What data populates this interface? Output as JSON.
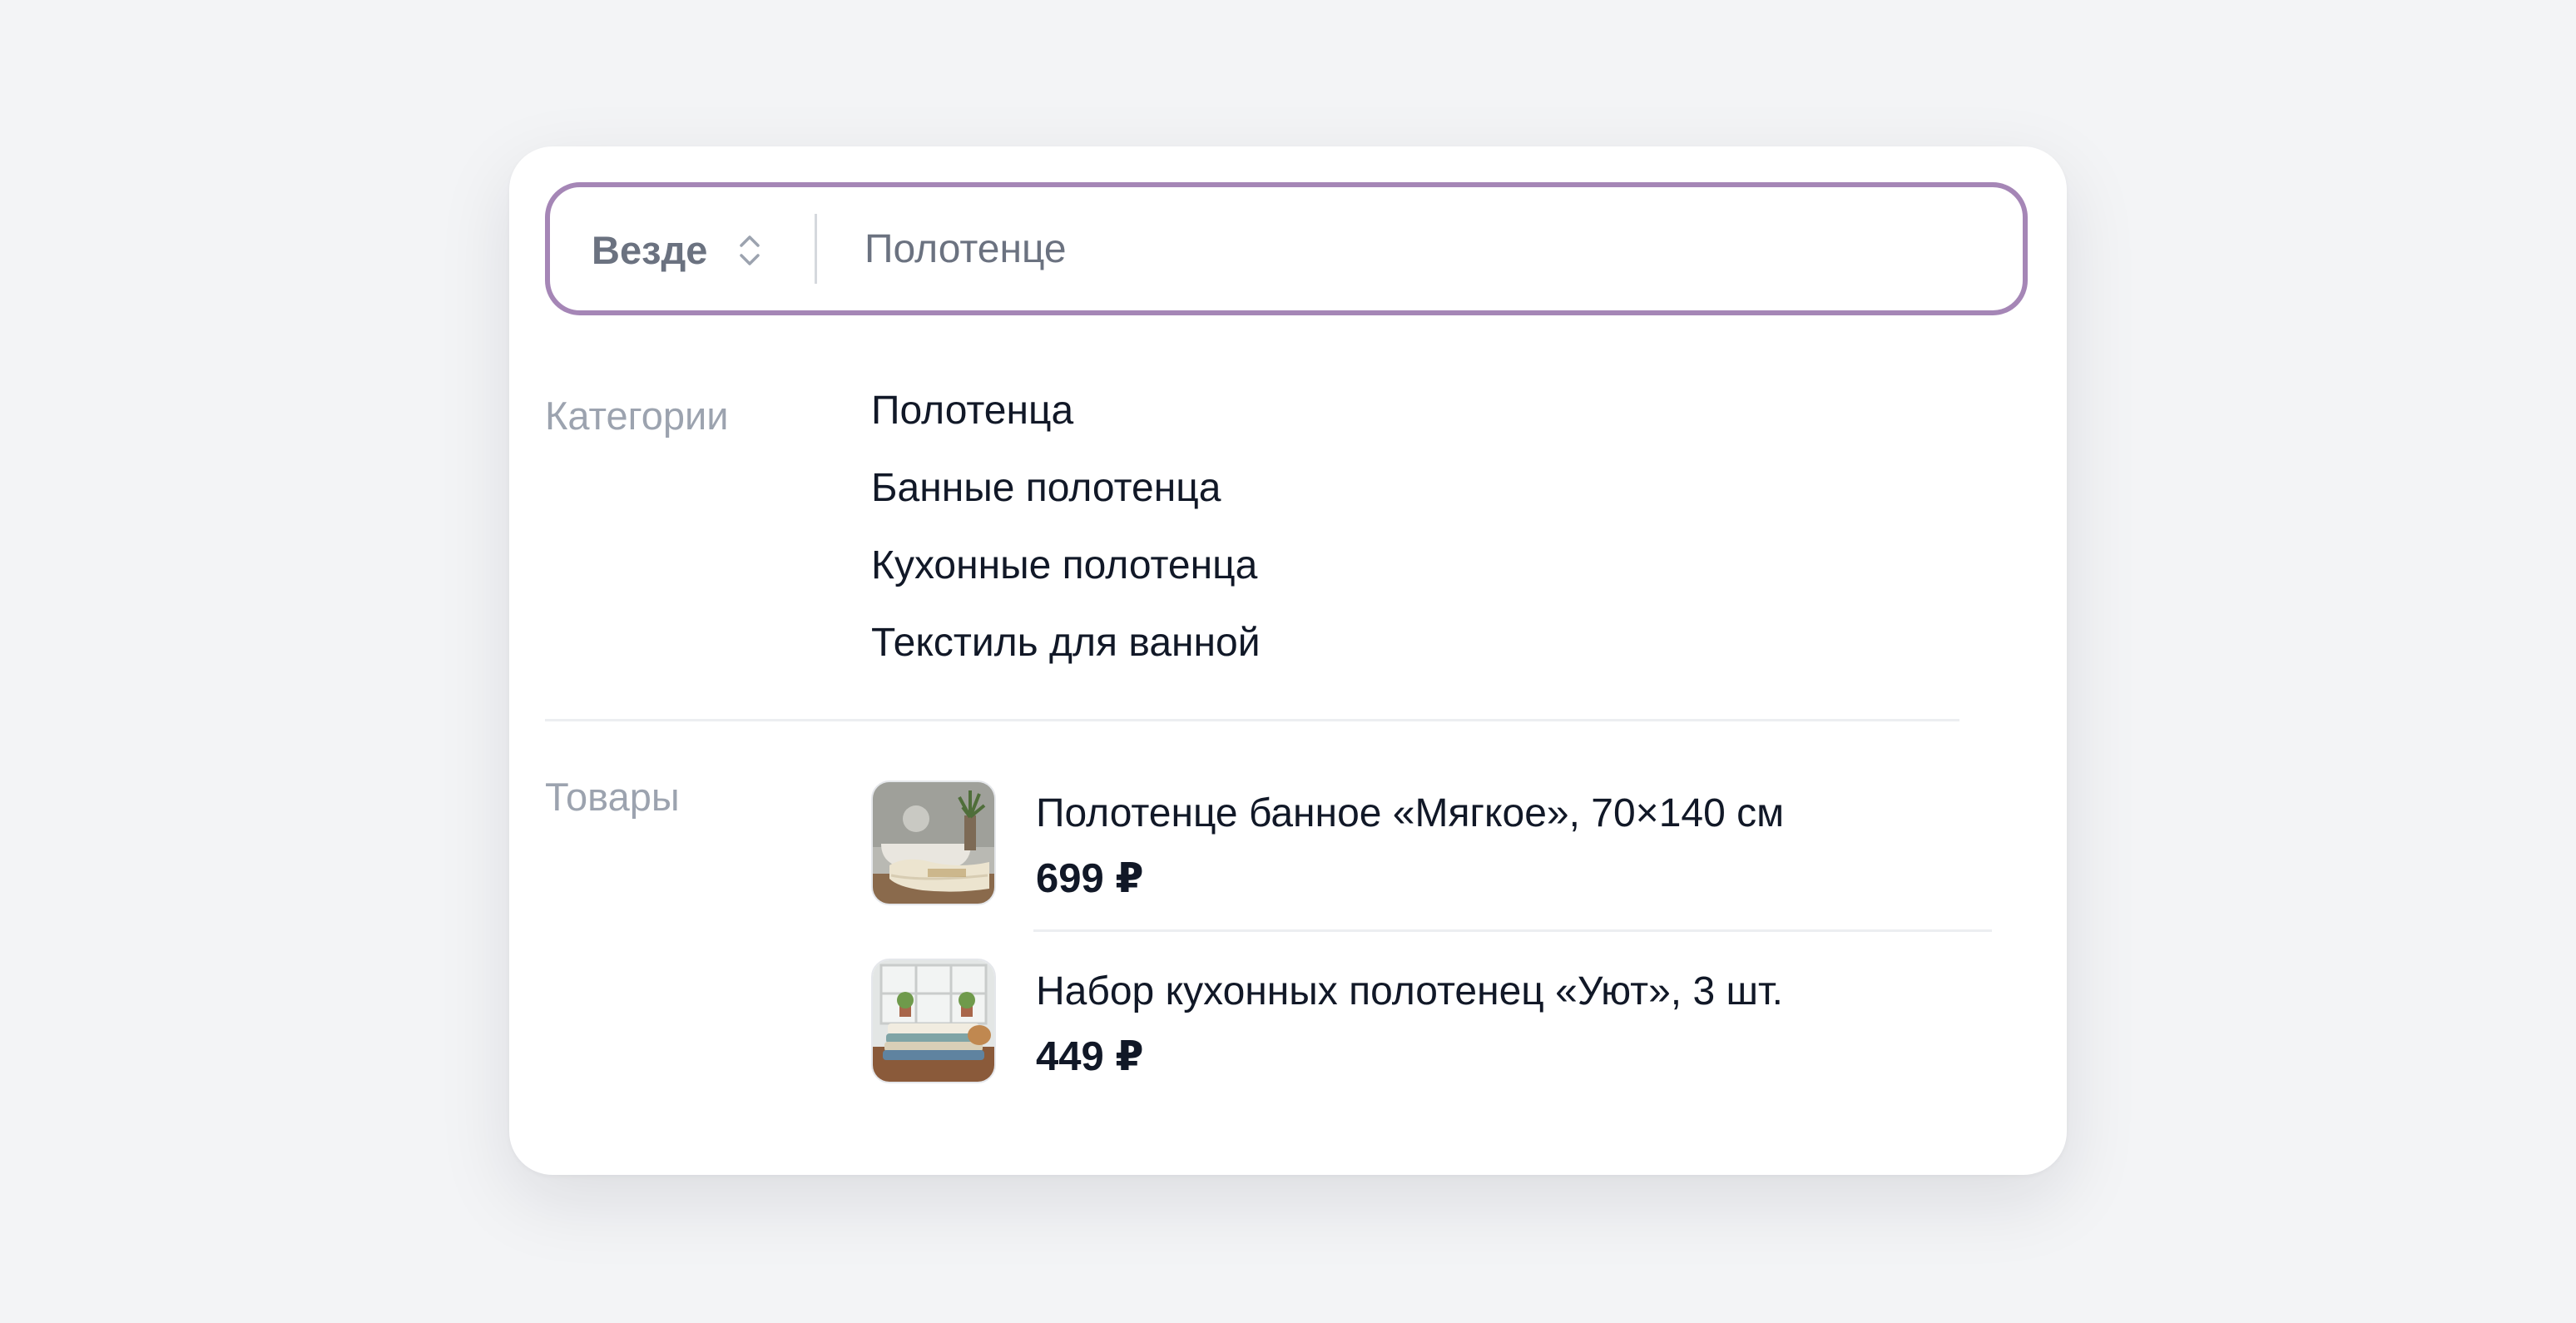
{
  "search": {
    "scope_label": "Везде",
    "query": "Полотенце"
  },
  "categories": {
    "label": "Категории",
    "items": [
      {
        "label": "Полотенца"
      },
      {
        "label": "Банные полотенца"
      },
      {
        "label": "Кухонные полотенца"
      },
      {
        "label": "Текстиль для ванной"
      }
    ]
  },
  "products": {
    "label": "Товары",
    "items": [
      {
        "name": "Полотенце банное «Мягкое», 70×140 см",
        "price": "699 ₽",
        "image_icon": "bath-towel-photo"
      },
      {
        "name": "Набор кухонных полотенец «Уют», 3 шт.",
        "price": "449 ₽",
        "image_icon": "kitchen-towels-photo"
      }
    ]
  },
  "colors": {
    "accent_border": "#a586b6",
    "text_primary": "#111827",
    "text_muted": "#9ca3af",
    "background": "#f3f4f6"
  }
}
